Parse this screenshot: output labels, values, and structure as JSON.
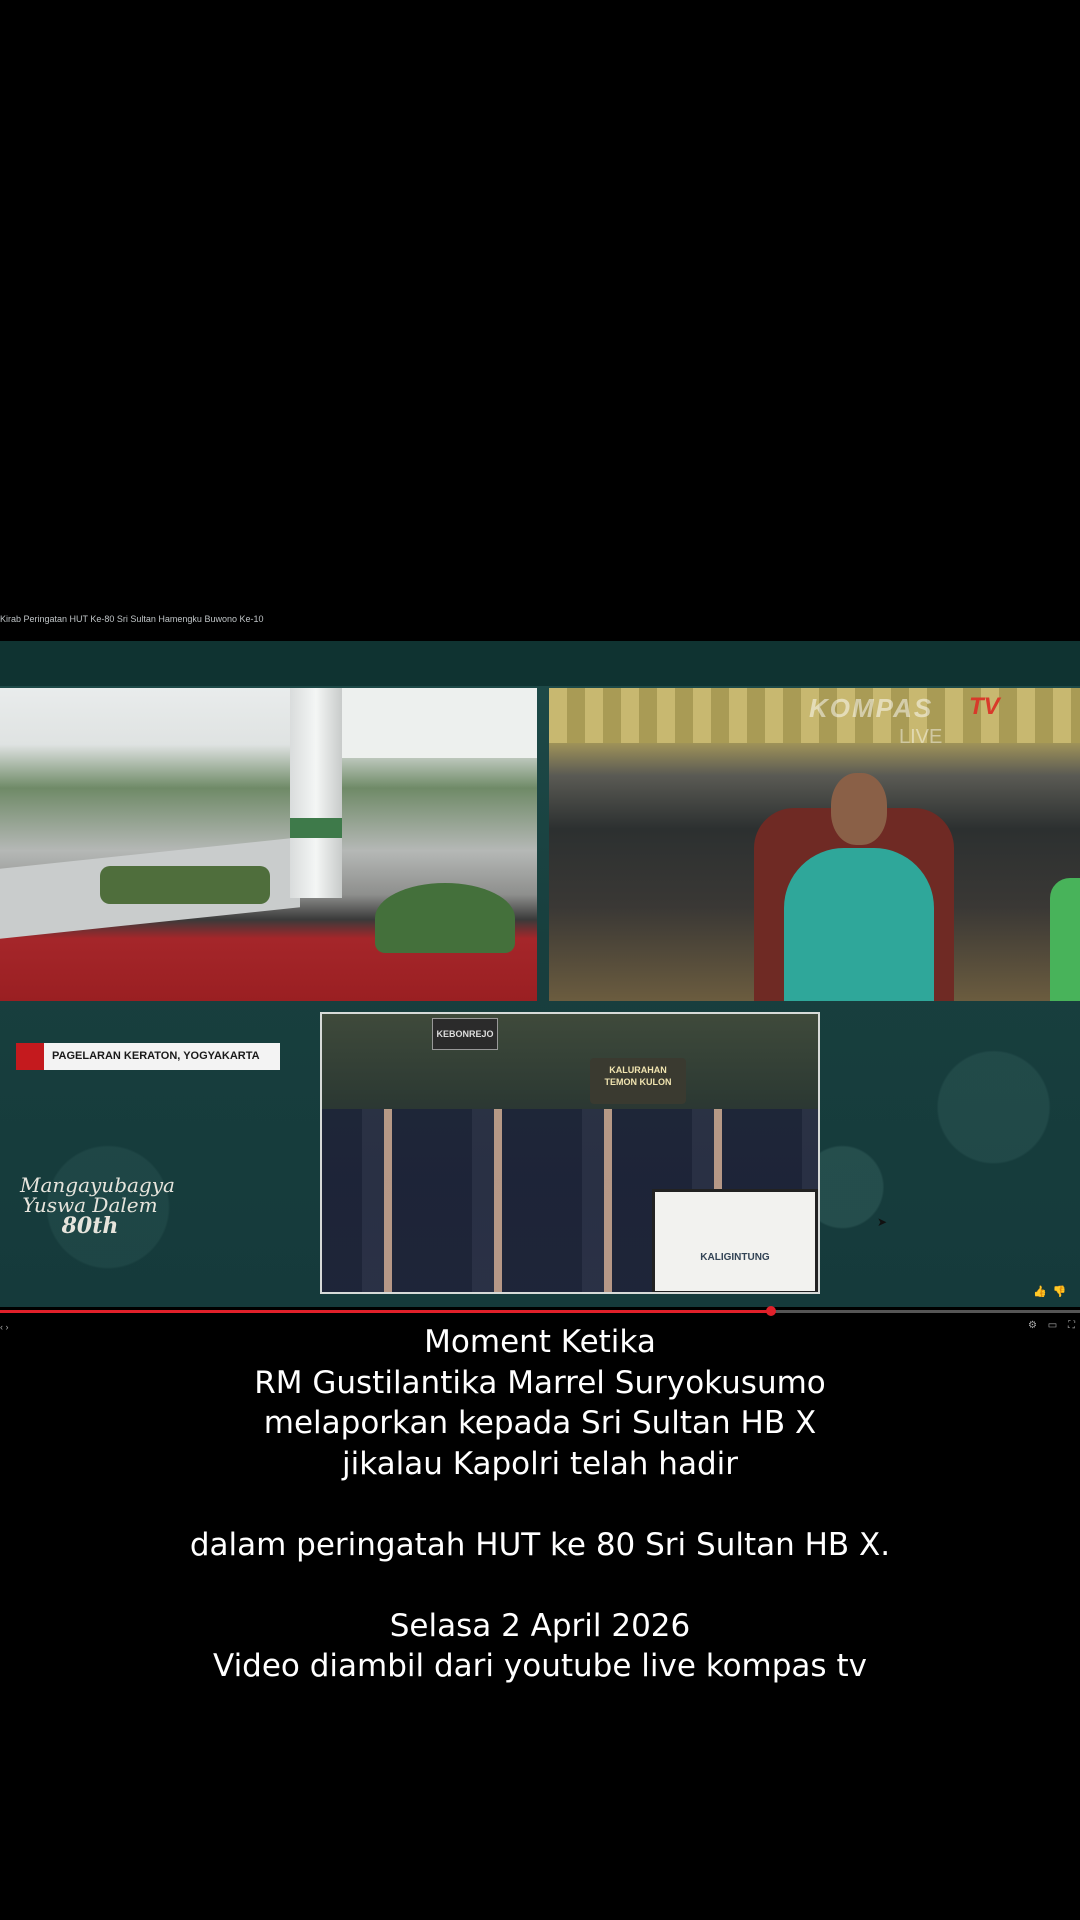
{
  "video": {
    "title": "Kirab Peringatan HUT Ke-80 Sri Sultan Hamengku Buwono Ke-10",
    "channel_logo": "KOMPAS",
    "channel_logo_tv": "TV",
    "live_label": "LIVE",
    "location_label": "PAGELARAN KERATON, YOGYAKARTA",
    "emblem": {
      "line1": "Mangayubagya",
      "line2": "Yuswa Dalem",
      "line3": "80th"
    },
    "signs": {
      "sign1": "KEBONREJO",
      "sign2_line1": "KALURAHAN",
      "sign2_line2": "TEMON KULON",
      "sign3": "KALIGINTUNG"
    },
    "progress_fraction": 0.714,
    "accent_color": "#e0202a",
    "controls": {
      "left": "‹  ›",
      "right": "⚙ ▭ ⛶"
    },
    "icons": {
      "like": "thumbs-up-icon",
      "dislike": "thumbs-down-icon"
    }
  },
  "caption": {
    "lines": [
      "Moment Ketika",
      "RM Gustilantika Marrel Suryokusumo",
      "melaporkan kepada Sri Sultan HB X",
      "jikalau Kapolri telah hadir",
      "",
      "dalam peringatah HUT ke 80 Sri Sultan HB X.",
      "",
      "Selasa 2 April 2026",
      "Video diambil dari youtube live kompas tv"
    ]
  }
}
